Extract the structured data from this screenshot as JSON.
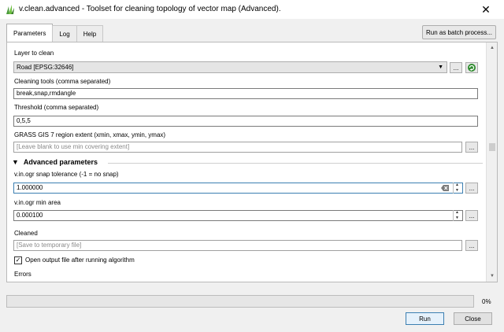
{
  "window": {
    "title": "v.clean.advanced - Toolset for cleaning topology of vector map (Advanced).",
    "close_glyph": "✕"
  },
  "tabs": [
    {
      "label": "Parameters",
      "active": true
    },
    {
      "label": "Log",
      "active": false
    },
    {
      "label": "Help",
      "active": false
    }
  ],
  "batch_button": "Run as batch process...",
  "params": {
    "layer_label": "Layer to clean",
    "layer_value": "Road [EPSG:32646]",
    "tools_label": "Cleaning tools (comma separated)",
    "tools_value": "break,snap,rmdangle",
    "threshold_label": "Threshold (comma separated)",
    "threshold_value": "0,5,5",
    "extent_label": "GRASS GIS 7 region extent (xmin, xmax, ymin, ymax)",
    "extent_placeholder": "[Leave blank to use min covering extent]",
    "advanced_header": "Advanced parameters",
    "snap_label": "v.in.ogr snap tolerance (-1 = no snap)",
    "snap_value": "1.000000",
    "minarea_label": "v.in.ogr min area",
    "minarea_value": "0.000100",
    "cleaned_label": "Cleaned",
    "cleaned_placeholder": "[Save to temporary file]",
    "open_output_label": "Open output file after running algorithm",
    "open_output_checked": true,
    "errors_label": "Errors",
    "browse_label": "..."
  },
  "progress": {
    "value": 0,
    "text": "0%"
  },
  "buttons": {
    "run": "Run",
    "close": "Close"
  },
  "colors": {
    "accent": "#3c7fb1",
    "iterate_icon": "#2e8b2e"
  }
}
